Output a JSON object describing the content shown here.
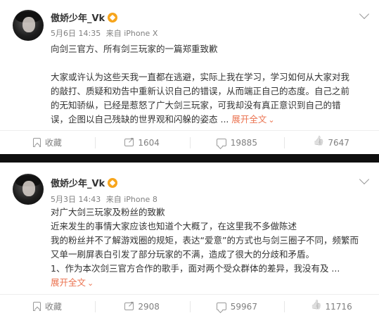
{
  "posts": [
    {
      "username": "傲娇少年_Vk",
      "time": "5月6日 14:35",
      "source": "来自 iPhone X",
      "lines": [
        "向剑三官方、所有剑三玩家的一篇郑重致歉",
        "",
        "大家或许认为这些天我一直都在逃避，实际上我在学习，学习如何从大家对我",
        "的敲打、质疑和劝告中重新认识自己的错误，从而端正自己的态度。自己之前",
        "的无知骄纵，已经是惹怒了广大剑三玩家，可我却没有真正意识到自己的错",
        "误，企图以自己残缺的世界观和闪躲的姿态 ..."
      ],
      "expand_label": "展开全文",
      "actions": {
        "favorite": "收藏",
        "share": "1604",
        "comment": "19885",
        "like": "7647"
      }
    },
    {
      "username": "傲娇少年_Vk",
      "time": "5月3日 14:43",
      "source": "来自 iPhone 8",
      "lines": [
        "对广大剑三玩家及粉丝的致歉",
        "近来发生的事情大家应该也知道个大概了，在这里我不多做陈述",
        "我的粉丝并不了解游戏圈的规矩，表达“爱意”的方式也与剑三圈子不同，频繁而",
        "又单一刷屏表白引发了部分玩家的不满，造成了很大的分歧和矛盾。",
        "1、作为本次剑三官方合作的歌手，面对两个受众群体的差异，我没有及 ..."
      ],
      "expand_label": "展开全文",
      "actions": {
        "favorite": "收藏",
        "share": "2908",
        "comment": "59967",
        "like": "11716"
      }
    }
  ],
  "icons": {
    "favorite": "bookmark-icon",
    "share": "share-icon",
    "comment": "comment-icon",
    "like": "thumbs-up-icon",
    "menu": "chevron-down-icon",
    "badge": "vip-badge-icon"
  },
  "colors": {
    "expand": "#eb7350",
    "meta": "#808080",
    "divider": "#0f0f0f"
  }
}
